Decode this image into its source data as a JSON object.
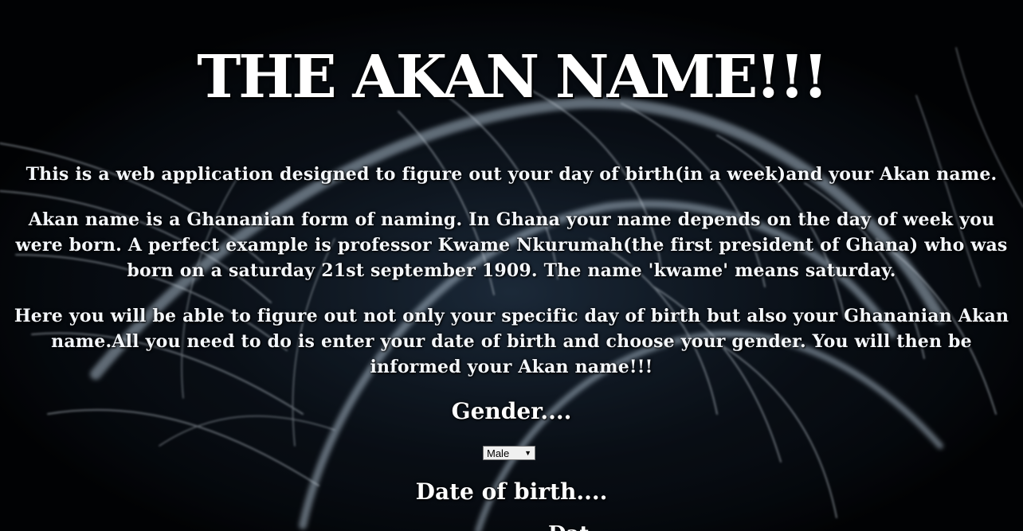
{
  "header": {
    "title": "THE AKAN NAME!!!"
  },
  "intro": {
    "paragraph_1": "This is a web application designed to figure out your day of birth(in a week)and your Akan name.",
    "paragraph_2": "Akan name is a Ghananian form of naming. In Ghana your name depends on the day of week you were born. A perfect example is professor Kwame Nkurumah(the first president of Ghana) who was born on a saturday 21st september 1909. The name 'kwame' means saturday.",
    "paragraph_3": "Here you will be able to figure out not only your specific day of birth but also your Ghananian Akan name.All you need to do is enter your date of birth and choose your gender. You will then be informed your Akan name!!!"
  },
  "form": {
    "gender_label": "Gender....",
    "gender_selected": "Male",
    "dob_label": "Date of birth....",
    "cutoff_text": "Dat"
  },
  "icons": {
    "select_arrow": "dropdown-arrow-icon"
  },
  "colors": {
    "background": "#05070b",
    "text": "#ffffff",
    "glow": "#cfe3f5"
  }
}
